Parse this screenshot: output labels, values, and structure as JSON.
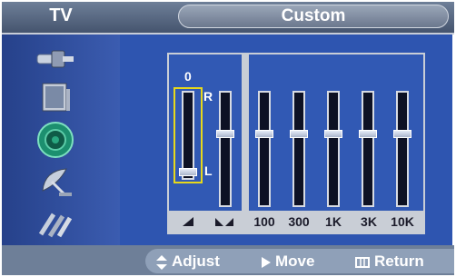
{
  "header": {
    "left_title": "TV",
    "title": "Custom"
  },
  "sidebar": {
    "items": [
      {
        "icon": "connector-icon"
      },
      {
        "icon": "tv-screen-icon"
      },
      {
        "icon": "speaker-icon"
      },
      {
        "icon": "satellite-dish-icon"
      },
      {
        "icon": "cables-icon"
      }
    ]
  },
  "equalizer": {
    "balance": {
      "value_label": "0",
      "right_label": "R",
      "left_label": "L",
      "value": 0
    },
    "bands": [
      {
        "label": "100",
        "value": 0
      },
      {
        "label": "300",
        "value": 0
      },
      {
        "label": "1K",
        "value": 0
      },
      {
        "label": "3K",
        "value": 0
      },
      {
        "label": "10K",
        "value": 0
      }
    ],
    "icons": [
      "balance-left-icon",
      "balance-right-icon"
    ]
  },
  "footer": {
    "adjust": "Adjust",
    "move": "Move",
    "return": "Return"
  },
  "colors": {
    "background": "#2e55b0",
    "highlight": "#e6d81b",
    "header": "#6e7f98"
  }
}
